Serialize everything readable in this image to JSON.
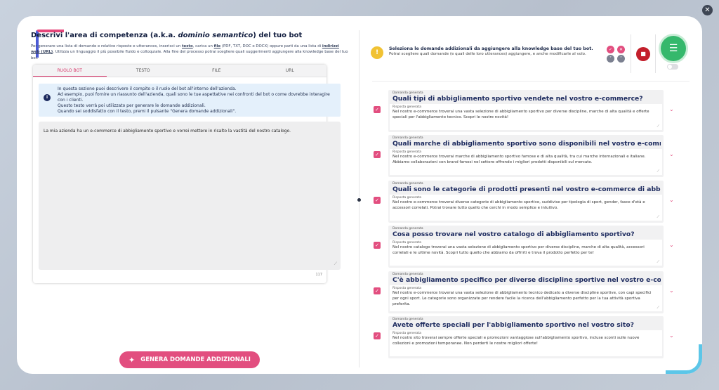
{
  "modal": {
    "close_icon": "close-icon"
  },
  "left": {
    "title_prefix": "Descrivi l'area di competenza (a.k.a. ",
    "title_italic": "dominio semantico",
    "title_suffix": ") del tuo bot",
    "intro_1": "Per generare una lista di domande e relative risposte e utterances, inserisci un ",
    "intro_testo": "testo",
    "intro_2": ", carica un ",
    "intro_file": "file",
    "intro_3": " (PDF, TXT, DOC o DOCX) oppure parti da una lista di ",
    "intro_url": "indirizzi web (URL)",
    "intro_4": ". Utilizza un linguaggio il più possibile fluido e colloquiale. Alla fine del processo potrai scegliere quali suggerimenti aggiungere alla knowledge base del tuo bot.",
    "tabs": [
      "RUOLO BOT",
      "TESTO",
      "FILE",
      "URL"
    ],
    "info_lines": [
      "In questa sezione puoi descrivere il compito o il ruolo del bot all'interno dell'azienda.",
      "Ad esempio, puoi fornire un riassunto dell'azienda, quali sono le tue aspettative nei confronti del bot o come dovrebbe interagire con i clienti.",
      "Questo testo verrà poi utilizzato per generare le domande addizionali.",
      "Quando sei soddisfatto con il testo, premi il pulsante \"Genera domande addizionali\"."
    ],
    "textarea_value": "La mia azienda ha un e-commerce di abbigliamento sportivo e vorrei mettere in risalto la vastità del nostro catalogo.",
    "char_count": "117",
    "generate_label": "GENERA DOMANDE ADDIZIONALI"
  },
  "right": {
    "title": "Seleziona le domande addizionali da aggiungere alla knowledge base del tuo bot.",
    "subtitle": "Potrai scegliere quali domande (e quali delle loro utterances) aggiungere, e anche modificarle al volo.",
    "question_label": "Domanda generata",
    "answer_label": "Risposta generata",
    "items": [
      {
        "question": "Quali tipi di abbigliamento sportivo vendete nel vostro e-commerce?",
        "answer": "Nel nostro e-commerce troverai una vasta selezione di abbigliamento sportivo per diverse discipline, marche di alta qualità e offerte speciali per l'abbigliamento tecnico. Scopri le nostre novità!"
      },
      {
        "question": "Quali marche di abbigliamento sportivo sono disponibili nel vostro e-commerce?",
        "answer": "Nel nostro e-commerce troverai marche di abbigliamento sportivo famose e di alta qualità, tra cui marche internazionali e italiane. Abbiamo collaborazioni con brand famosi nel settore offrendo i migliori prodotti disponibili sul mercato."
      },
      {
        "question": "Quali sono le categorie di prodotti presenti nel vostro e-commerce di abbigliamento sportivo?",
        "answer": "Nel nostro e-commerce troverai diverse categorie di abbigliamento sportivo, suddivise per tipologia di sport, gender, fasce d'età e accessori correlati. Potrai trovare tutto quello che cerchi in modo semplice e intuitivo."
      },
      {
        "question": "Cosa posso trovare nel vostro catalogo di abbigliamento sportivo?",
        "answer": "Nel nostro catalogo troverai una vasta selezione di abbigliamento sportivo per diverse discipline, marche di alta qualità, accessori correlati e le ultime novità. Scopri tutto quello che abbiamo da offrirti e trova il prodotto perfetto per te!"
      },
      {
        "question": "C'è abbigliamento specifico per diverse discipline sportive nel vostro e-commerce?",
        "answer": "Nel nostro e-commerce troverai una vasta selezione di abbigliamento tecnico dedicato a diverse discipline sportive, con capi specifici per ogni sport. Le categorie sono organizzate per rendere facile la ricerca dell'abbigliamento perfetto per la tua attività sportiva preferita."
      },
      {
        "question": "Avete offerte speciali per l'abbigliamento sportivo nel vostro sito?",
        "answer": "Nel nostro sito troverai sempre offerte speciali e promozioni vantaggiose sull'abbigliamento sportivo, incluse sconti sulle nuove collezioni e promozioni temporanee. Non perderti le nostre migliori offerte!"
      }
    ]
  }
}
